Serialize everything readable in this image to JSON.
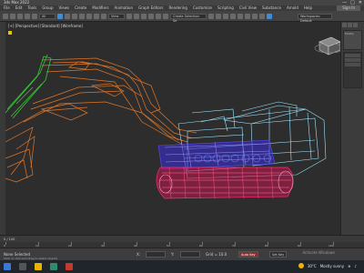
{
  "window": {
    "title": "3ds Max 2022",
    "controls": [
      "—",
      "□",
      "✕"
    ]
  },
  "menu": {
    "items": [
      "File",
      "Edit",
      "Tools",
      "Group",
      "Views",
      "Create",
      "Modifiers",
      "Animation",
      "Graph Editors",
      "Rendering",
      "Customize",
      "Scripting",
      "Civil View",
      "Substance",
      "Arnold",
      "Help"
    ],
    "signin": "Sign In",
    "workspace": "Workspaces: Default"
  },
  "toolbar": {
    "create_selection_set": "Create Selection Se"
  },
  "viewport": {
    "label": "[+] [Perspective] [Standard] [Wireframe]"
  },
  "command_panel": {
    "title": "Modify"
  },
  "timeslider": {
    "frame": "0 / 100"
  },
  "trackbar": {
    "ticks": [
      "0",
      "10",
      "20",
      "30",
      "40",
      "50",
      "60",
      "70",
      "80",
      "90",
      "100"
    ]
  },
  "status": {
    "selected": "None Selected",
    "hint": "Click or click-and-drag to select objects",
    "x_label": "X:",
    "y_label": "Y:",
    "grid": "Grid = 10.0",
    "autokey": "Auto Key",
    "setkey": "Set Key",
    "activate": "Activate Windows"
  },
  "taskbar": {
    "weather": "30°C",
    "weather_desc": "Mostly sunny",
    "time": "",
    "date": ""
  },
  "colors": {
    "excavator_arm": "#e0762a",
    "arm_tip": "#35c735",
    "track": "#e0206a",
    "body": "#9fe6ff",
    "engine": "#4a3cff"
  }
}
